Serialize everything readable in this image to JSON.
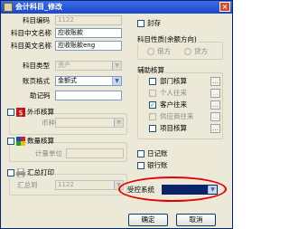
{
  "window": {
    "title": "会计科目_修改",
    "close_glyph": "×"
  },
  "form": {
    "code": {
      "label": "科目编码",
      "value": "1122"
    },
    "cn_name": {
      "label": "科目中文名称",
      "value": "应收账款"
    },
    "en_name": {
      "label": "科目英文名称",
      "value": "应收账款eng"
    },
    "type": {
      "label": "科目类型",
      "value": "资产"
    },
    "page_format": {
      "label": "账页格式",
      "value": "金额式"
    },
    "mnemonic": {
      "label": "助记码",
      "value": ""
    }
  },
  "foreign": {
    "label": "外币核算",
    "currency_label": "币种",
    "currency_value": ""
  },
  "quantity": {
    "label": "数量核算",
    "unit_label": "计量单位",
    "unit_value": ""
  },
  "summary_print": {
    "label": "汇总打印",
    "to_label": "汇总到",
    "to_value": "1122"
  },
  "sealed": {
    "label": "封存",
    "checked": false
  },
  "nature": {
    "label": "科目性质(余额方向)",
    "options": [
      "借方",
      "贷方"
    ],
    "selected": "借方"
  },
  "aux": {
    "label": "辅助核算",
    "items": [
      {
        "label": "部门核算",
        "checked": false,
        "enabled": true
      },
      {
        "label": "个人往来",
        "checked": false,
        "enabled": false
      },
      {
        "label": "客户往来",
        "checked": true,
        "enabled": true
      },
      {
        "label": "供应商往来",
        "checked": false,
        "enabled": false
      },
      {
        "label": "项目核算",
        "checked": false,
        "enabled": true
      }
    ]
  },
  "journals": {
    "cash_journal": {
      "label": "日记账",
      "checked": false
    },
    "bank_journal": {
      "label": "银行账",
      "checked": false
    }
  },
  "controlled_system": {
    "label": "受控系统",
    "value": ""
  },
  "buttons": {
    "ok": "确定",
    "cancel": "取消"
  },
  "glyphs": {
    "check": "✓",
    "dropdown": "▼",
    "browse": "…"
  },
  "colors": {
    "title_bar": "#1c46c8",
    "highlight_ring": "#e20000",
    "selected_combo": "#0a246a"
  }
}
